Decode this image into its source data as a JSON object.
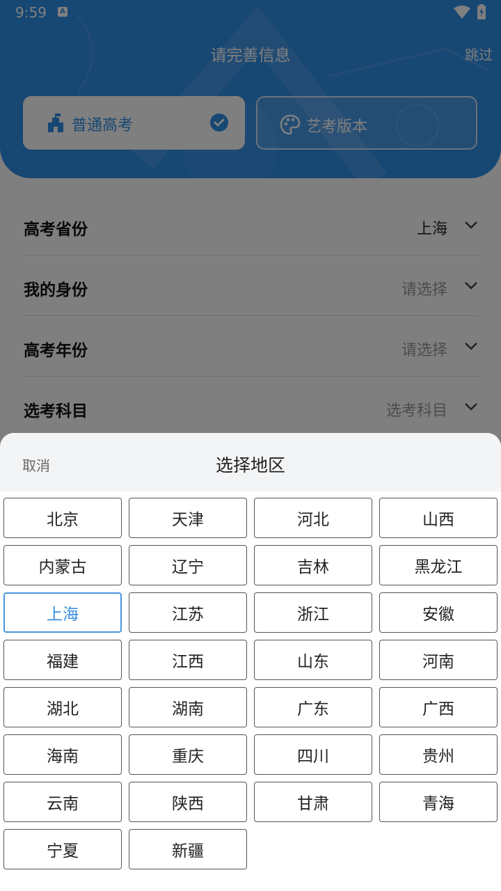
{
  "status_bar": {
    "time": "9:59",
    "notification_letter": "A",
    "icons": [
      "wifi-icon",
      "battery-icon"
    ]
  },
  "header": {
    "title": "请完善信息",
    "skip_label": "跳过",
    "background_color": "#2f8ee6"
  },
  "exam_types": [
    {
      "label": "普通高考",
      "icon": "school-icon",
      "selected": true
    },
    {
      "label": "艺考版本",
      "icon": "palette-icon",
      "selected": false
    }
  ],
  "form": {
    "rows": [
      {
        "label": "高考省份",
        "value": "上海",
        "filled": true
      },
      {
        "label": "我的身份",
        "value": "请选择",
        "filled": false
      },
      {
        "label": "高考年份",
        "value": "请选择",
        "filled": false
      },
      {
        "label": "选考科目",
        "value": "选考科目",
        "filled": false
      }
    ]
  },
  "picker": {
    "cancel_label": "取消",
    "title": "选择地区",
    "selected": "上海",
    "selected_color": "#3a8ee0",
    "regions": [
      "北京",
      "天津",
      "河北",
      "山西",
      "内蒙古",
      "辽宁",
      "吉林",
      "黑龙江",
      "上海",
      "江苏",
      "浙江",
      "安徽",
      "福建",
      "江西",
      "山东",
      "河南",
      "湖北",
      "湖南",
      "广东",
      "广西",
      "海南",
      "重庆",
      "四川",
      "贵州",
      "云南",
      "陕西",
      "甘肃",
      "青海",
      "宁夏",
      "新疆"
    ]
  }
}
